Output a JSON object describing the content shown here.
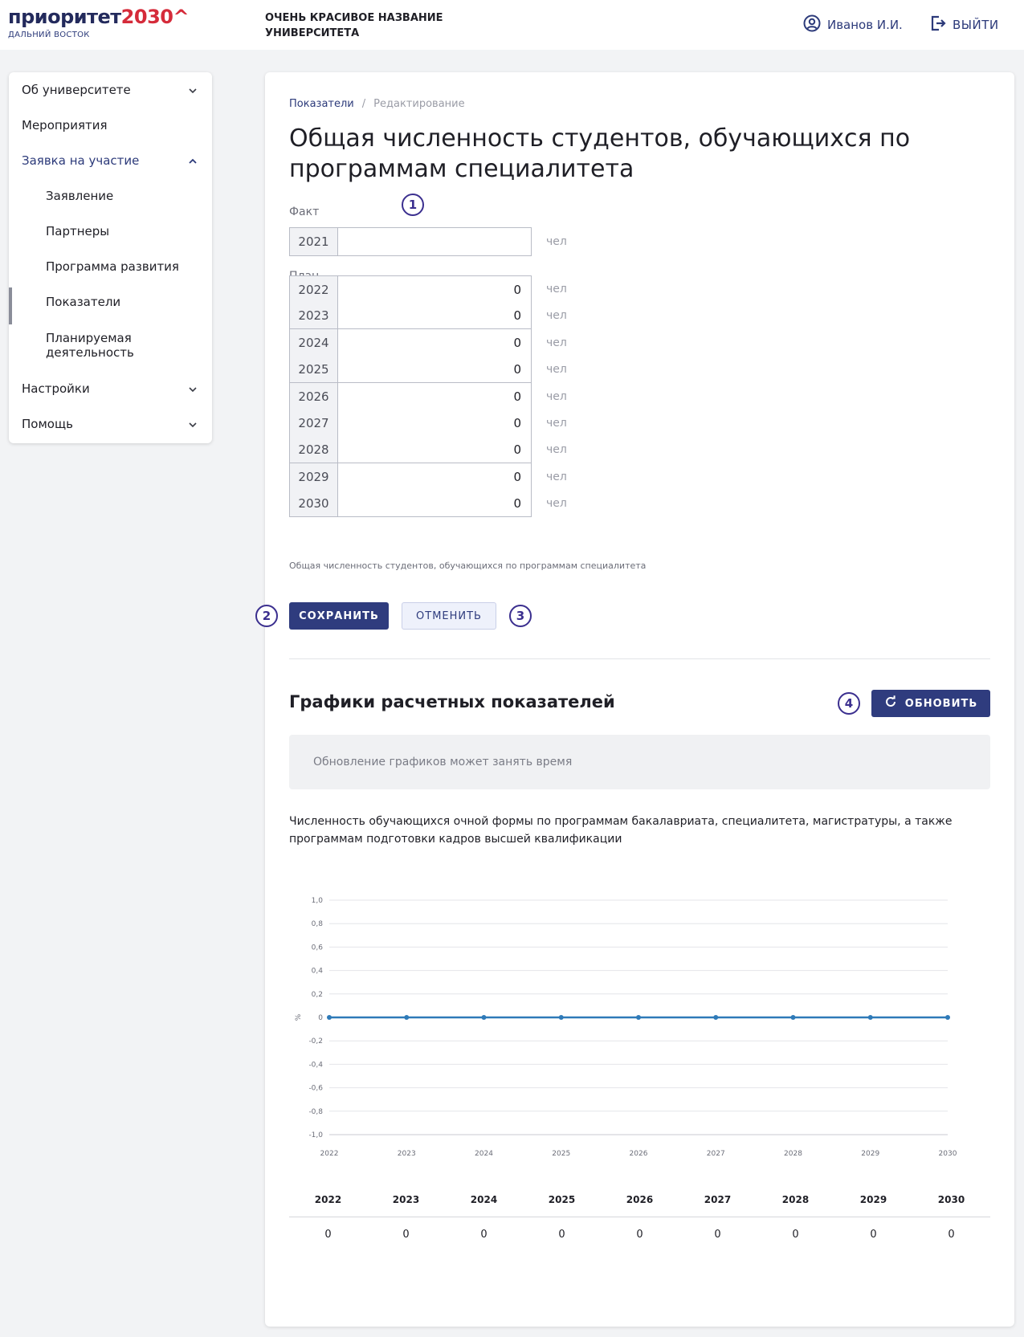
{
  "header": {
    "logo_text": "приоритет",
    "logo_number": "2030^",
    "logo_subtitle": "ДАЛЬНИЙ ВОСТОК",
    "university_name": "ОЧЕНЬ КРАСИВОЕ НАЗВАНИЕ УНИВЕРСИТЕТА",
    "user_name": "Иванов И.И.",
    "logout_label": "ВЫЙТИ"
  },
  "sidebar": {
    "items": [
      {
        "label": "Об университете",
        "chevron": "down"
      },
      {
        "label": "Мероприятия"
      },
      {
        "label": "Заявка на участие",
        "chevron": "up"
      },
      {
        "label": "Заявление"
      },
      {
        "label": "Партнеры"
      },
      {
        "label": "Программа развития"
      },
      {
        "label": "Показатели"
      },
      {
        "label": "Планируемая деятельность"
      },
      {
        "label": "Настройки",
        "chevron": "down"
      },
      {
        "label": "Помощь",
        "chevron": "down"
      }
    ]
  },
  "breadcrumb": {
    "link": "Показатели",
    "separator": "/",
    "current": "Редактирование"
  },
  "page_title": "Общая численность студентов, обучающихся по программам специалитета",
  "markers": [
    "1",
    "2",
    "3",
    "4"
  ],
  "fact": {
    "label": "Факт",
    "year": "2021",
    "value": "",
    "unit": "чел"
  },
  "plan": {
    "label": "План",
    "rows": [
      {
        "year": "2022",
        "value": "0",
        "unit": "чел"
      },
      {
        "year": "2023",
        "value": "0",
        "unit": "чел"
      },
      {
        "year": "2024",
        "value": "0",
        "unit": "чел"
      },
      {
        "year": "2025",
        "value": "0",
        "unit": "чел"
      },
      {
        "year": "2026",
        "value": "0",
        "unit": "чел"
      },
      {
        "year": "2027",
        "value": "0",
        "unit": "чел"
      },
      {
        "year": "2028",
        "value": "0",
        "unit": "чел"
      },
      {
        "year": "2029",
        "value": "0",
        "unit": "чел"
      },
      {
        "year": "2030",
        "value": "0",
        "unit": "чел"
      }
    ]
  },
  "hint": "Общая численность студентов, обучающихся по программам специалитета",
  "buttons": {
    "save": "СОХРАНИТЬ",
    "cancel": "ОТМЕНИТЬ",
    "refresh": "ОБНОВИТЬ"
  },
  "charts_section": {
    "title": "Графики расчетных показателей",
    "notice": "Обновление графиков может занять время",
    "caption": "Численность обучающихся очной формы по программам бакалавриата, специалитета, магистратуры, а также программам подготовки кадров высшей квалификации"
  },
  "chart_data": {
    "type": "line",
    "x": [
      "2022",
      "2023",
      "2024",
      "2025",
      "2026",
      "2027",
      "2028",
      "2029",
      "2030"
    ],
    "series": [
      {
        "values": [
          0,
          0,
          0,
          0,
          0,
          0,
          0,
          0,
          0
        ]
      }
    ],
    "ylabel": "%",
    "ylim": [
      -1.0,
      1.0
    ],
    "yticks": [
      "1,0",
      "0,8",
      "0,6",
      "0,4",
      "0,2",
      "0",
      "-0,2",
      "-0,4",
      "-0,6",
      "-0,8",
      "-1,0"
    ],
    "grid": true,
    "line_color": "#2e7ab8"
  },
  "table": {
    "headers": [
      "2022",
      "2023",
      "2024",
      "2025",
      "2026",
      "2027",
      "2028",
      "2029",
      "2030"
    ],
    "values": [
      "0",
      "0",
      "0",
      "0",
      "0",
      "0",
      "0",
      "0",
      "0"
    ]
  },
  "colors": {
    "brand_navy": "#2f3c7e",
    "logo_red": "#d52b3a",
    "marker": "#3b2f8f"
  }
}
